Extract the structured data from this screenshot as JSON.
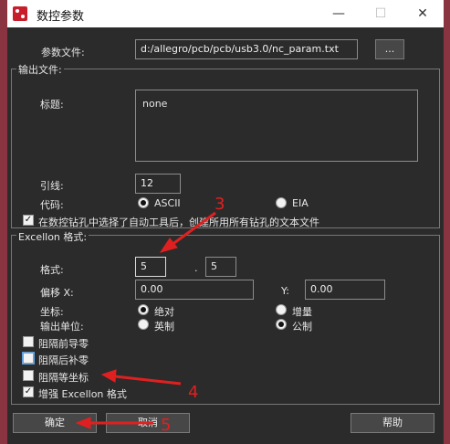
{
  "window": {
    "title": "数控参数",
    "minimize_icon": "minimize-icon",
    "maximize_icon": "maximize-icon",
    "close_icon": "close-icon"
  },
  "param_file": {
    "label": "参数文件:",
    "value": "d:/allegro/pcb/pcb/usb3.0/nc_param.txt",
    "browse_label": "..."
  },
  "output_file": {
    "group_title": "输出文件:",
    "header_label": "标题:",
    "header_value": "none",
    "leader_label": "引线:",
    "leader_value": "12",
    "code_label": "代码:",
    "code_options": [
      {
        "label": "ASCII",
        "checked": true
      },
      {
        "label": "EIA",
        "checked": false
      }
    ],
    "auto_tool_label": "在数控钻孔中选择了自动工具后，创建所用所有钻孔的文本文件",
    "auto_tool_checked": true
  },
  "excellon": {
    "group_title": "Excellon 格式:",
    "format_label": "格式:",
    "format_int": "5",
    "format_dot": ".",
    "format_dec": "5",
    "offset_x_label": "偏移 X:",
    "offset_x_value": "0.00",
    "offset_y_label": "Y:",
    "offset_y_value": "0.00",
    "coord_label": "坐标:",
    "coord_options": [
      {
        "label": "绝对",
        "checked": true
      },
      {
        "label": "增量",
        "checked": false
      }
    ],
    "unit_label": "输出单位:",
    "unit_options": [
      {
        "label": "英制",
        "checked": false
      },
      {
        "label": "公制",
        "checked": true
      }
    ],
    "checkboxes": [
      {
        "label": "阻隔前导零",
        "checked": false
      },
      {
        "label": "阻隔后补零",
        "checked": false
      },
      {
        "label": "阻隔等坐标",
        "checked": false
      },
      {
        "label": "增强 Excellon 格式",
        "checked": true
      }
    ]
  },
  "buttons": {
    "ok": "确定",
    "cancel": "取消",
    "help": "帮助"
  },
  "annotations": {
    "n3": "3",
    "n4": "4",
    "n5": "5",
    "color": "#e02020"
  }
}
